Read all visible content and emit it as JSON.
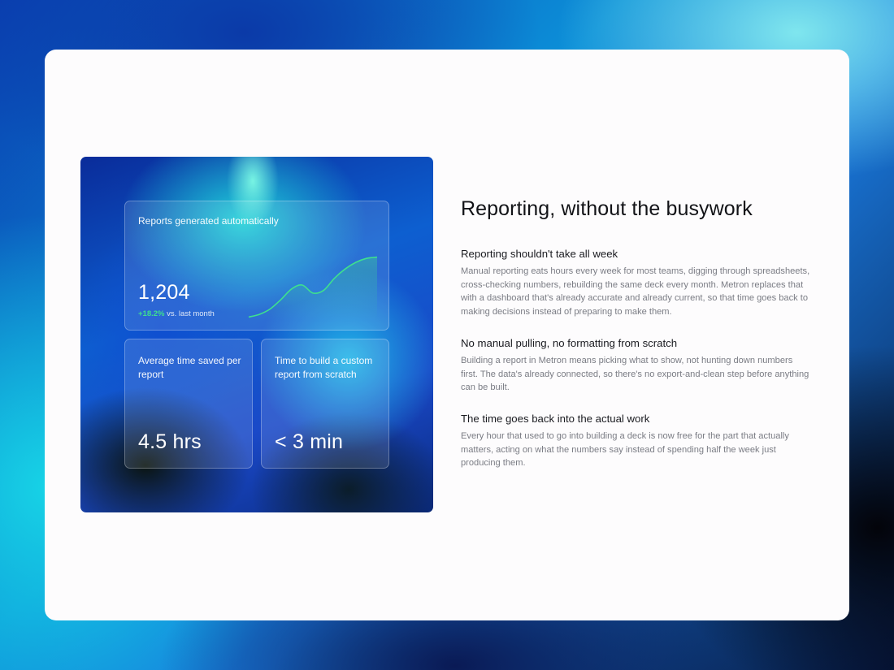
{
  "stats": {
    "reports": {
      "label": "Reports generated automatically",
      "value": "1,204",
      "delta_value": "+18.2%",
      "delta_text": "vs. last month"
    },
    "time_saved": {
      "label": "Average time saved per report",
      "value": "4.5 hrs"
    },
    "build_time": {
      "label": "Time to build a custom report from scratch",
      "value": "< 3 min"
    }
  },
  "chart_data": {
    "type": "area",
    "x": [
      0,
      1,
      2,
      3,
      4,
      5,
      6,
      7,
      8,
      9,
      10,
      11,
      12
    ],
    "values": [
      2,
      6,
      14,
      28,
      44,
      50,
      38,
      42,
      60,
      74,
      84,
      90,
      92
    ],
    "ylim": [
      0,
      100
    ],
    "color": "#3ee08f",
    "grid": false
  },
  "content": {
    "heading": "Reporting, without the busywork",
    "sections": [
      {
        "title": "Reporting shouldn't take all week",
        "body": "Manual reporting eats hours every week for most teams, digging through spreadsheets, cross-checking numbers, rebuilding the same deck every month. Metron replaces that with a dashboard that's already accurate and already current, so that time goes back to making decisions instead of preparing to make them."
      },
      {
        "title": "No manual pulling, no formatting from scratch",
        "body": "Building a report in Metron means picking what to show, not hunting down numbers first. The data's already connected, so there's no export-and-clean step before anything can be built."
      },
      {
        "title": "The time goes back into the actual work",
        "body": "Every hour that used to go into building a deck is now free for the part that actually matters, acting on what the numbers say instead of spending half the week just producing them."
      }
    ]
  }
}
